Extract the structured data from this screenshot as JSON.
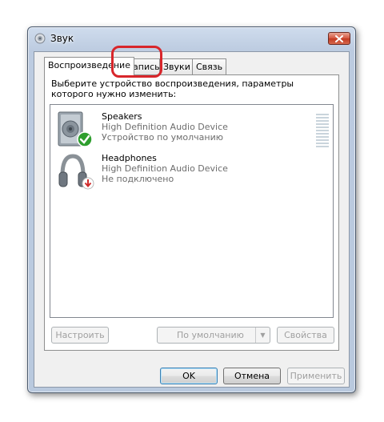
{
  "window": {
    "title": "Звук",
    "icon": "speaker-icon",
    "close_icon": "close-icon"
  },
  "tabs": [
    {
      "label": "Воспроизведение",
      "active": true
    },
    {
      "label": "Запись",
      "active": false,
      "highlighted": true
    },
    {
      "label": "Звуки",
      "active": false
    },
    {
      "label": "Связь",
      "active": false
    }
  ],
  "instruction": "Выберите устройство воспроизведения, параметры которого нужно изменить:",
  "devices": [
    {
      "name": "Speakers",
      "driver": "High Definition Audio Device",
      "status": "Устройство по умолчанию",
      "icon": "speakers-icon",
      "badge": "default-check-icon",
      "badge_color": "#2e9e2e"
    },
    {
      "name": "Headphones",
      "driver": "High Definition Audio Device",
      "status": "Не подключено",
      "icon": "headphones-icon",
      "badge": "disconnected-arrow-icon",
      "badge_color": "#d02c2c"
    }
  ],
  "list_buttons": {
    "configure": "Настроить",
    "set_default": "По умолчанию",
    "properties": "Свойства"
  },
  "dialog_buttons": {
    "ok": "OK",
    "cancel": "Отмена",
    "apply": "Применить"
  },
  "colors": {
    "highlight_ring": "#d8262b",
    "accent_border": "#3c7fb1"
  }
}
